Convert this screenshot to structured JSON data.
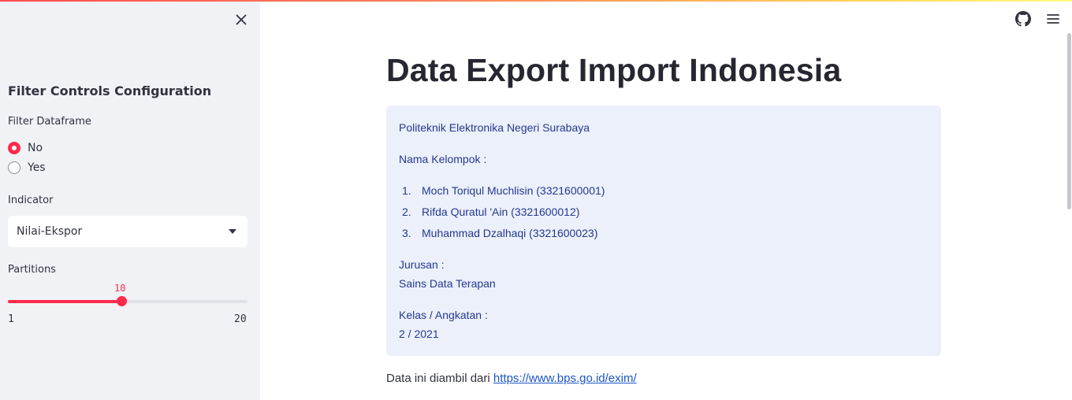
{
  "sidebar": {
    "title": "Filter Controls Configuration",
    "filter_label": "Filter Dataframe",
    "filter_options": [
      "No",
      "Yes"
    ],
    "filter_selected": "No",
    "indicator_label": "Indicator",
    "indicator_value": "Nilai-Ekspor",
    "partitions_label": "Partitions",
    "partitions_value": "10",
    "partitions_min": "1",
    "partitions_max": "20",
    "partitions_fraction": 0.4737
  },
  "header": {
    "icons": [
      "github-icon",
      "hamburger-menu-icon"
    ]
  },
  "main": {
    "title": "Data Export Import Indonesia",
    "info": {
      "institution": "Politeknik Elektronika Negeri Surabaya",
      "group_label": "Nama Kelompok :",
      "members": [
        "Moch Toriqul Muchlisin (3321600001)",
        "Rifda Quratul 'Ain (3321600012)",
        "Muhammad Dzalhaqi (3321600023)"
      ],
      "member_numbers": [
        "1.",
        "2.",
        "3."
      ],
      "major_label": "Jurusan :",
      "major_value": "Sains Data Terapan",
      "class_label": "Kelas / Angkatan :",
      "class_value": "2 / 2021"
    },
    "source_prefix": "Data ini diambil dari ",
    "source_link": "https://www.bps.go.id/exim/"
  },
  "colors": {
    "accent": "#ff2b4c",
    "sidebar_bg": "#f0f2f6",
    "info_bg": "#ebf0fb",
    "info_text": "#26398f",
    "link": "#1c56c4"
  }
}
